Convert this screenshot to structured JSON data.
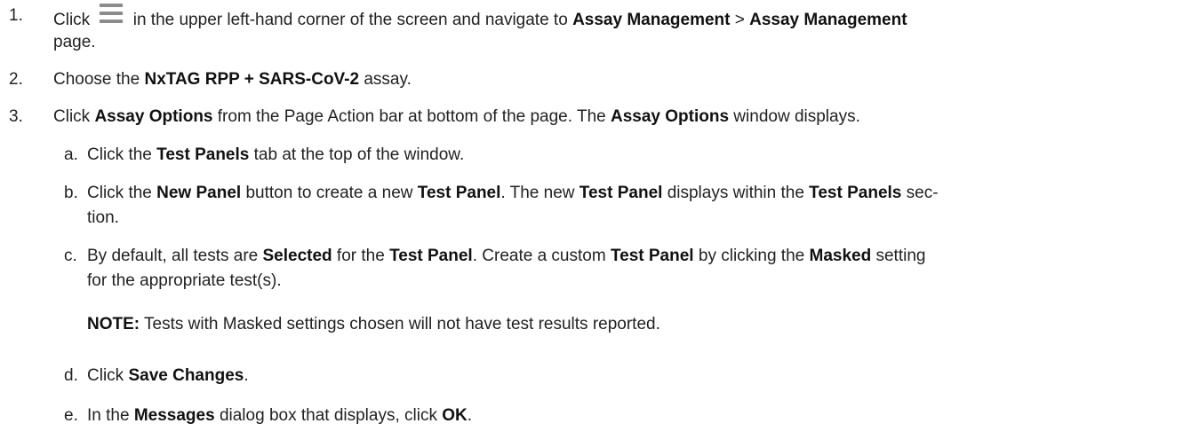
{
  "steps": [
    {
      "num": "1.",
      "parts": [
        {
          "t": "Click ",
          "b": false
        },
        {
          "icon": "hamburger-menu-icon"
        },
        {
          "t": " in the upper left-hand corner of the screen and navigate to ",
          "b": false
        },
        {
          "t": "Assay Management",
          "b": true
        },
        {
          "t": " > ",
          "b": false
        },
        {
          "t": "Assay Management",
          "b": true
        }
      ],
      "line2": "page."
    },
    {
      "num": "2.",
      "parts": [
        {
          "t": "Choose the ",
          "b": false
        },
        {
          "t": "NxTAG RPP + SARS-CoV-2",
          "b": true
        },
        {
          "t": " assay.",
          "b": false
        }
      ]
    },
    {
      "num": "3.",
      "parts": [
        {
          "t": "Click ",
          "b": false
        },
        {
          "t": "Assay Options",
          "b": true
        },
        {
          "t": " from the Page Action bar at bottom of the page. The ",
          "b": false
        },
        {
          "t": "Assay Options",
          "b": true
        },
        {
          "t": " window displays.",
          "b": false
        }
      ]
    }
  ],
  "substeps": [
    {
      "num": "a.",
      "lines": [
        [
          {
            "t": "Click the ",
            "b": false
          },
          {
            "t": "Test Panels",
            "b": true
          },
          {
            "t": " tab at the top of the window.",
            "b": false
          }
        ]
      ]
    },
    {
      "num": "b.",
      "lines": [
        [
          {
            "t": "Click the ",
            "b": false
          },
          {
            "t": "New Panel",
            "b": true
          },
          {
            "t": " button to create a new ",
            "b": false
          },
          {
            "t": "Test Panel",
            "b": true
          },
          {
            "t": ". The new ",
            "b": false
          },
          {
            "t": "Test Panel",
            "b": true
          },
          {
            "t": " displays within the ",
            "b": false
          },
          {
            "t": "Test Panels",
            "b": true
          },
          {
            "t": " sec-",
            "b": false
          }
        ],
        [
          {
            "t": "tion.",
            "b": false
          }
        ]
      ]
    },
    {
      "num": "c.",
      "lines": [
        [
          {
            "t": "By default, all tests are ",
            "b": false
          },
          {
            "t": "Selected",
            "b": true
          },
          {
            "t": " for the ",
            "b": false
          },
          {
            "t": "Test Panel",
            "b": true
          },
          {
            "t": ". Create a custom ",
            "b": false
          },
          {
            "t": "Test Panel",
            "b": true
          },
          {
            "t": " by clicking the ",
            "b": false
          },
          {
            "t": "Masked",
            "b": true
          },
          {
            "t": " setting",
            "b": false
          }
        ],
        [
          {
            "t": "for the appropriate test(s).",
            "b": false
          }
        ]
      ]
    },
    {
      "num": "d.",
      "lines": [
        [
          {
            "t": "Click ",
            "b": false
          },
          {
            "t": "Save Changes",
            "b": true
          },
          {
            "t": ".",
            "b": false
          }
        ]
      ]
    },
    {
      "num": "e.",
      "lines": [
        [
          {
            "t": "In the ",
            "b": false
          },
          {
            "t": "Messages",
            "b": true
          },
          {
            "t": " dialog box that displays, click ",
            "b": false
          },
          {
            "t": "OK",
            "b": true
          },
          {
            "t": ".",
            "b": false
          }
        ]
      ]
    }
  ],
  "note": {
    "label": "NOTE:",
    "text": " Tests with Masked settings chosen will not have test results reported."
  }
}
